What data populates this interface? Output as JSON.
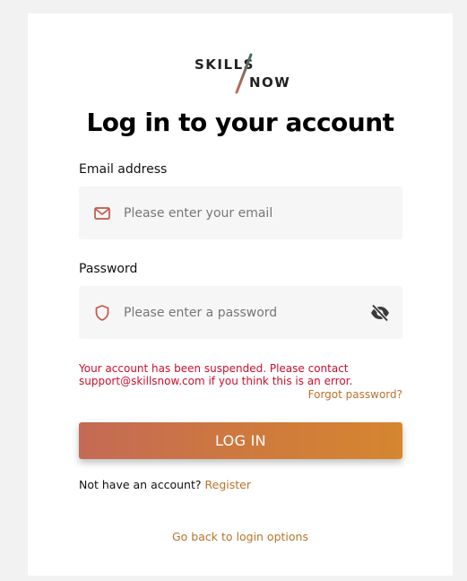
{
  "logo": {
    "word1": "SKILLS",
    "word2": "NOW",
    "slash_colors": [
      "#3f6b5f",
      "#c96a55"
    ]
  },
  "title": "Log in to your account",
  "email": {
    "label": "Email address",
    "placeholder": "Please enter your email",
    "value": "",
    "icon": "mail-icon"
  },
  "password": {
    "label": "Password",
    "placeholder": "Please enter a password",
    "value": "",
    "icon": "shield-icon",
    "toggle_icon": "eye-slash-icon"
  },
  "error_message": "Your account has been suspended. Please contact support@skillsnow.com if you think this is an error.",
  "forgot_password": "Forgot password?",
  "login_button": "LOG IN",
  "register": {
    "prompt": "Not have an account?",
    "link": "Register"
  },
  "back_link": "Go back to login options",
  "colors": {
    "accent": "#b8732a",
    "error": "#c8102e",
    "icon": "#c0584a",
    "button_start": "#c46a55",
    "button_end": "#d5862f"
  }
}
